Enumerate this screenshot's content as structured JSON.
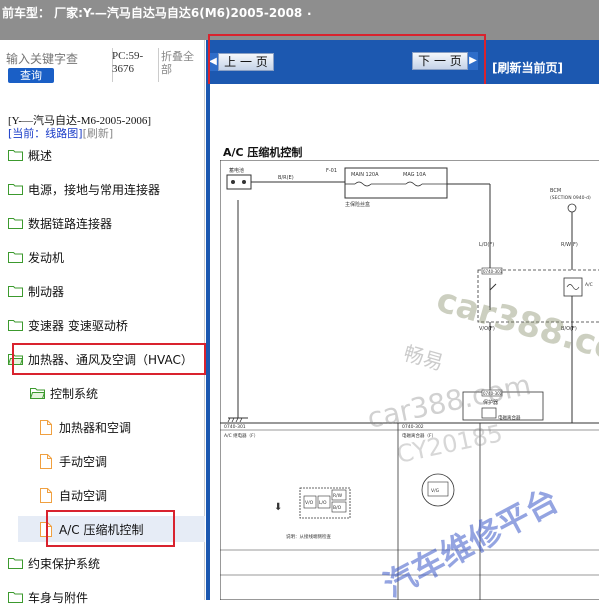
{
  "header": {
    "title": "前车型：  厂家:Y-—汽马自达马自达6(M6)2005-2008",
    "dot": "."
  },
  "sidebar": {
    "search_placeholder": "输入关键字查",
    "search_button": "查询",
    "pc_code": "PC:59-3676",
    "collapse_all": "折叠全部",
    "breadcrumb": "[Y-—汽马自达-M6-2005-2006]",
    "current_prefix": "[当前：",
    "current_value": "线路图]",
    "refresh": "[刷新]",
    "items": [
      {
        "label": "概述",
        "type": "folder"
      },
      {
        "label": "电源，接地与常用连接器",
        "type": "folder"
      },
      {
        "label": "数据链路连接器",
        "type": "folder"
      },
      {
        "label": "发动机",
        "type": "folder"
      },
      {
        "label": "制动器",
        "type": "folder"
      },
      {
        "label": "变速器 变速驱动桥",
        "type": "folder"
      },
      {
        "label": "加热器、通风及空调（HVAC）",
        "type": "folder-open"
      },
      {
        "label": "控制系统",
        "type": "folder-open"
      },
      {
        "label": "加热器和空调",
        "type": "file"
      },
      {
        "label": "手动空调",
        "type": "file"
      },
      {
        "label": "自动空调",
        "type": "file"
      },
      {
        "label": "A/C 压缩机控制",
        "type": "file"
      },
      {
        "label": "约束保护系统",
        "type": "folder"
      },
      {
        "label": "车身与附件",
        "type": "folder"
      }
    ]
  },
  "nav": {
    "prev": "上 一 页",
    "next": "下 一 页",
    "refresh_page": "[刷新当前页]"
  },
  "document": {
    "title": "A/C 压缩机控制",
    "labels": {
      "main_fuse": "MAIN 120A",
      "mag_fuse": "MAG 10A",
      "fuse_box": "主保险丝盒",
      "battery": "蓄电池",
      "f01": "F-01",
      "wire_br": "B/R(E)",
      "bcm": "BCM",
      "bcm_section": "(SECTION 0940-d)",
      "wire_lo": "L/O(F)",
      "wire_rw": "R/W(F)",
      "conn1": "0740-301",
      "conn2": "0740-302",
      "wire_vo": "V/O(F)",
      "wire_bo": "B/O(F)",
      "compressor_short": "A/C",
      "diode": "二极管",
      "protect": "保护器",
      "relay_box": "电磁离合器",
      "bottom_left": "A/C 继电器（F）",
      "bottom_right": "电磁离合器（F）",
      "caption": "说明：从接线端侧检查",
      "pin_rw": "R/W",
      "pin_bo": "B/O",
      "pin_vo": "V/O",
      "pin_lo": "L/O",
      "pin_vg": "V/G"
    }
  },
  "watermark": {
    "cn1": "畅易",
    "car388": "car388.com",
    "cy": "CY20185",
    "site": "汽车维修平台",
    "car388b": "car388.co"
  },
  "colors": {
    "nav_blue": "#1c58b0",
    "highlight_red": "#d9232e",
    "folder_green": "#3c9a2e",
    "file_orange": "#f0a040"
  }
}
